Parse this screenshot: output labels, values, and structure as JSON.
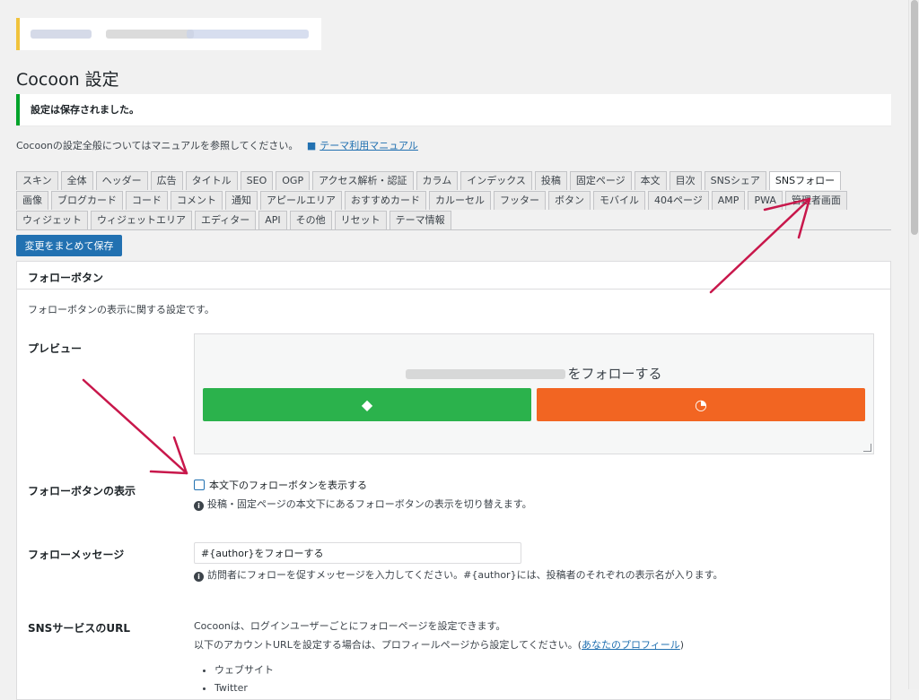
{
  "page": {
    "title": "Cocoon 設定",
    "saved_notice": "設定は保存されました。",
    "intro_text": "Cocoonの設定全般についてはマニュアルを参照してください。",
    "manual_link": "テーマ利用マニュアル",
    "save_button": "変更をまとめて保存"
  },
  "tabs": {
    "row1": [
      "スキン",
      "全体",
      "ヘッダー",
      "広告",
      "タイトル",
      "SEO",
      "OGP",
      "アクセス解析・認証",
      "カラム",
      "インデックス",
      "投稿",
      "固定ページ",
      "本文",
      "目次",
      "SNSシェア",
      "SNSフォロー"
    ],
    "row2": [
      "画像",
      "ブログカード",
      "コード",
      "コメント",
      "通知",
      "アピールエリア",
      "おすすめカード",
      "カルーセル",
      "フッター",
      "ボタン",
      "モバイル",
      "404ページ",
      "AMP",
      "PWA",
      "管理者画面"
    ],
    "row3": [
      "ウィジェット",
      "ウィジェットエリア",
      "エディター",
      "API",
      "その他",
      "リセット",
      "テーマ情報"
    ],
    "active": "SNSフォロー"
  },
  "panel": {
    "title": "フォローボタン",
    "description": "フォローボタンの表示に関する設定です。",
    "preview_label": "プレビュー",
    "preview_message": "をフォローする",
    "display_label": "フォローボタンの表示",
    "display_checkbox": "本文下のフォローボタンを表示する",
    "display_hint": "投稿・固定ページの本文下にあるフォローボタンの表示を切り替えます。",
    "message_label": "フォローメッセージ",
    "message_value": "#{author}をフォローする",
    "message_hint": "訪問者にフォローを促すメッセージを入力してください。#{author}には、投稿者のそれぞれの表示名が入ります。",
    "sns_label": "SNSサービスのURL",
    "sns_text1": "Cocoonは、ログインユーザーごとにフォローページを設定できます。",
    "sns_text2": "以下のアカウントURLを設定する場合は、プロフィールページから設定してください。(",
    "sns_profile_link": "あなたのプロフィール",
    "sns_text2_end": ")",
    "sns_items": [
      "ウェブサイト",
      "Twitter"
    ]
  },
  "colors": {
    "feedly": "#2bb24c",
    "rss": "#f26522",
    "primary": "#2271b1",
    "arrow": "#c8174b"
  }
}
